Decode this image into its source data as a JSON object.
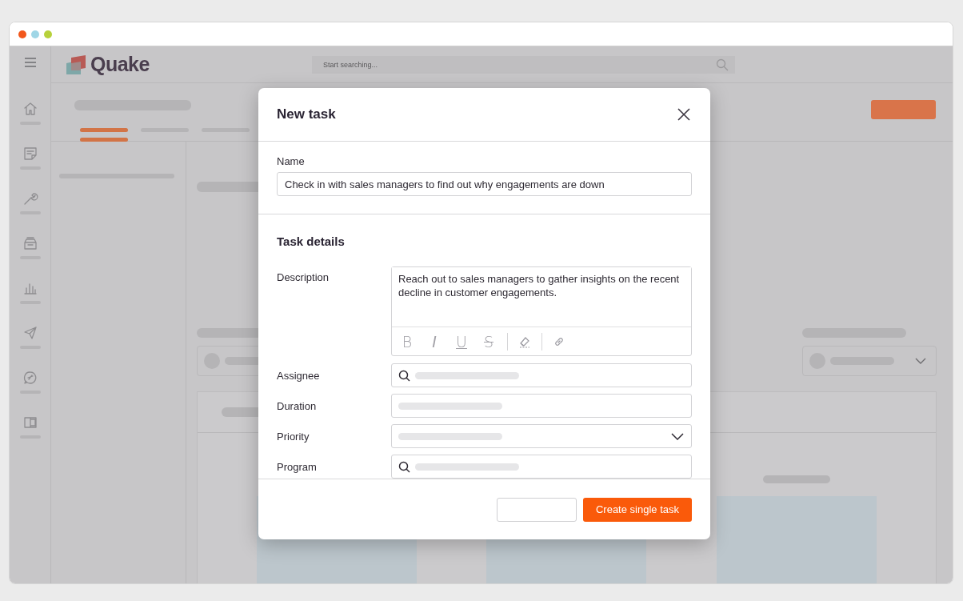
{
  "app": {
    "logo": "Quake",
    "search": {
      "placeholder": "Start searching..."
    },
    "sidebar": [
      {
        "kind": "home"
      },
      {
        "kind": "note"
      },
      {
        "kind": "wrench"
      },
      {
        "kind": "inbox"
      },
      {
        "kind": "chart"
      },
      {
        "kind": "send"
      },
      {
        "kind": "chat"
      },
      {
        "kind": "panel"
      }
    ],
    "tabs": [
      {
        "selected": true
      },
      {
        "selected": false
      },
      {
        "selected": false
      }
    ]
  },
  "dialog": {
    "title": "New task",
    "name": {
      "label": "Name",
      "value": "Check in with sales managers to find out why engagements are down"
    },
    "section_title": "Task details",
    "fields": [
      {
        "kind": "textarea",
        "label": "Description",
        "value": "Reach out to sales managers to gather insights on the recent decline in customer engagements.",
        "toolbar": [
          {
            "kind": "bold",
            "label": "B"
          },
          {
            "kind": "italic",
            "label": "I"
          },
          {
            "kind": "underline",
            "label": "U"
          },
          {
            "kind": "strike",
            "label": "S"
          },
          {
            "kind": "divider"
          },
          {
            "kind": "eraser"
          },
          {
            "kind": "divider"
          },
          {
            "kind": "link"
          }
        ]
      },
      {
        "kind": "search",
        "label": "Assignee"
      },
      {
        "kind": "text",
        "label": "Duration"
      },
      {
        "kind": "select",
        "label": "Priority"
      },
      {
        "kind": "search",
        "label": "Program"
      }
    ],
    "buttons": [
      {
        "kind": "secondary"
      },
      {
        "kind": "primary",
        "label": "Create single task"
      }
    ]
  }
}
